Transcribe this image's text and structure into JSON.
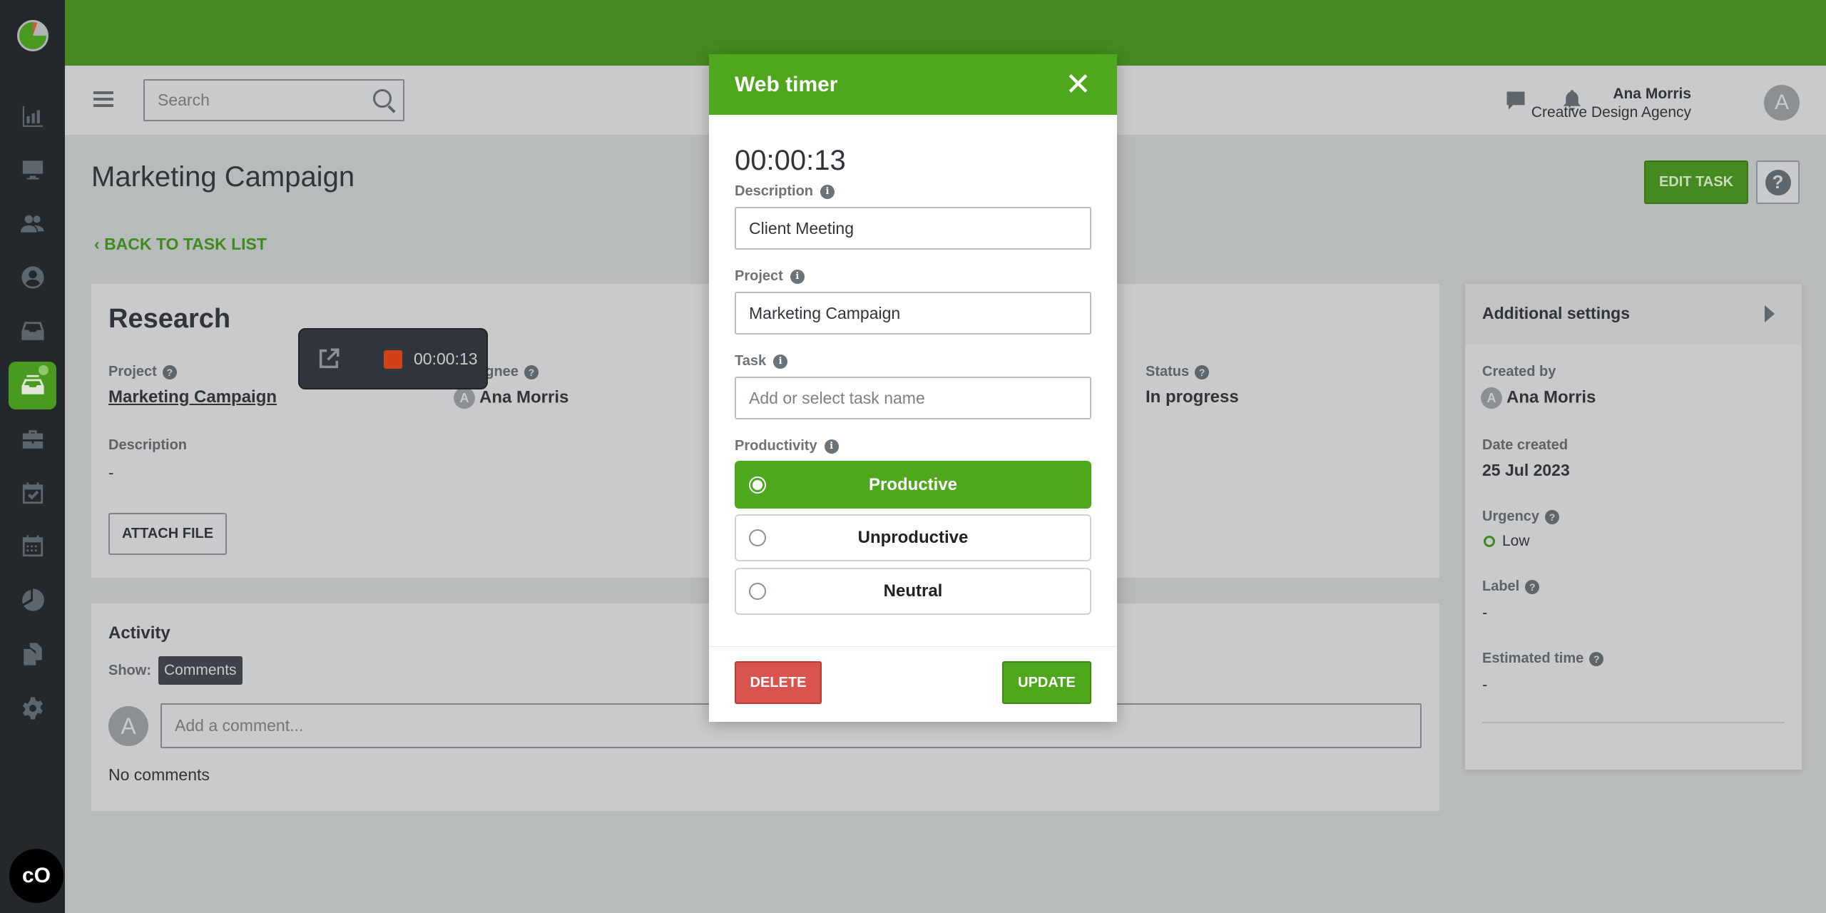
{
  "colors": {
    "brand_green": "#4fa71e",
    "top_bar": "#458a20",
    "sidebar": "#23282d",
    "delete": "#d9534f",
    "urgency_low": "#3f8a1f"
  },
  "sidebar": {
    "items": [
      {
        "icon": "bar-chart-icon"
      },
      {
        "icon": "monitor-icon"
      },
      {
        "icon": "users-icon"
      },
      {
        "icon": "user-circle-icon"
      },
      {
        "icon": "inbox-icon"
      },
      {
        "icon": "tasks-inbox-icon",
        "active": true
      },
      {
        "icon": "briefcase-icon"
      },
      {
        "icon": "calendar-check-icon"
      },
      {
        "icon": "calendar-icon"
      },
      {
        "icon": "pie-chart-icon"
      },
      {
        "icon": "documents-icon"
      },
      {
        "icon": "gear-icon"
      }
    ]
  },
  "header": {
    "search_placeholder": "Search",
    "user_name": "Ana Morris",
    "company": "Creative Design Agency",
    "avatar_letter": "A"
  },
  "page": {
    "title": "Marketing Campaign",
    "back_link": "BACK TO TASK LIST",
    "edit_button": "EDIT TASK",
    "help_button": "?"
  },
  "task": {
    "name": "Research",
    "project_label": "Project",
    "project_value": "Marketing Campaign",
    "assignee_label": "Assignee",
    "assignee_value": "Ana Morris",
    "status_label": "Status",
    "status_value": "In progress",
    "description_label": "Description",
    "description_value": "-",
    "attach_button": "ATTACH FILE"
  },
  "timer_widget": {
    "time": "00:00:13"
  },
  "activity": {
    "title": "Activity",
    "show_label": "Show:",
    "filter": "Comments",
    "comment_placeholder": "Add a comment...",
    "avatar_letter": "A",
    "empty": "No comments"
  },
  "settings": {
    "title": "Additional settings",
    "created_by_label": "Created by",
    "created_by_value": "Ana Morris",
    "date_label": "Date created",
    "date_value": "25 Jul 2023",
    "urgency_label": "Urgency",
    "urgency_value": "Low",
    "label_label": "Label",
    "label_value": "-",
    "estimated_label": "Estimated time",
    "estimated_value": "-"
  },
  "modal": {
    "title": "Web timer",
    "time": "00:00:13",
    "description_label": "Description",
    "description_value": "Client Meeting",
    "project_label": "Project",
    "project_value": "Marketing Campaign",
    "task_label": "Task",
    "task_placeholder": "Add or select task name",
    "productivity_label": "Productivity",
    "options": [
      {
        "label": "Productive",
        "selected": true
      },
      {
        "label": "Unproductive",
        "selected": false
      },
      {
        "label": "Neutral",
        "selected": false
      }
    ],
    "delete_button": "DELETE",
    "update_button": "UPDATE"
  }
}
